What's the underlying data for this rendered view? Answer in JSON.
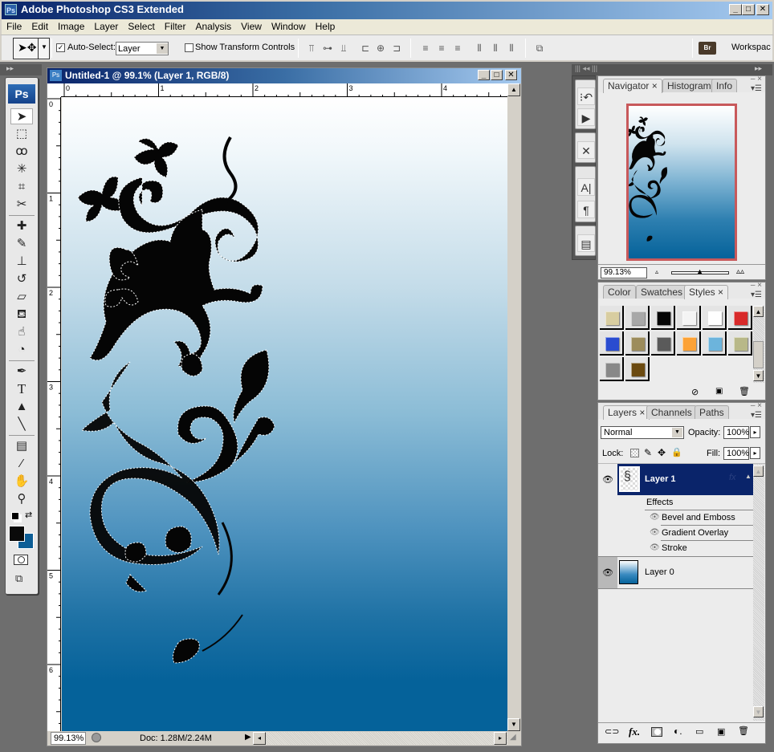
{
  "app": {
    "title": "Adobe Photoshop CS3 Extended",
    "logo": "Ps",
    "window_controls": {
      "minimize": "_",
      "maximize": "□",
      "close": "✕"
    }
  },
  "menu": [
    "File",
    "Edit",
    "Image",
    "Layer",
    "Select",
    "Filter",
    "Analysis",
    "View",
    "Window",
    "Help"
  ],
  "options_bar": {
    "tool_icon": "move-tool-icon",
    "auto_select_checked": true,
    "auto_select_label": "Auto-Select:",
    "auto_select_value": "Layer",
    "show_transform_checked": false,
    "show_transform_label": "Show Transform Controls",
    "workspace_label": "Workspac",
    "bridge_label": "Br"
  },
  "toolbox": {
    "logo": "Ps",
    "tools": [
      {
        "name": "move-tool",
        "glyph": "➤"
      },
      {
        "name": "marquee-tool",
        "glyph": "⬚"
      },
      {
        "name": "lasso-tool",
        "glyph": "ꝏ"
      },
      {
        "name": "magic-wand-tool",
        "glyph": "✳"
      },
      {
        "name": "crop-tool",
        "glyph": "⌗"
      },
      {
        "name": "slice-tool",
        "glyph": "✂"
      },
      {
        "name": "healing-brush-tool",
        "glyph": "✚"
      },
      {
        "name": "brush-tool",
        "glyph": "✎"
      },
      {
        "name": "clone-stamp-tool",
        "glyph": "⊥"
      },
      {
        "name": "history-brush-tool",
        "glyph": "↺"
      },
      {
        "name": "eraser-tool",
        "glyph": "▱"
      },
      {
        "name": "paint-bucket-tool",
        "glyph": "⛾"
      },
      {
        "name": "blur-tool",
        "glyph": "☝"
      },
      {
        "name": "dodge-tool",
        "glyph": "◔"
      },
      {
        "name": "pen-tool",
        "glyph": "✒"
      },
      {
        "name": "type-tool",
        "glyph": "T"
      },
      {
        "name": "path-selection-tool",
        "glyph": "▲"
      },
      {
        "name": "line-tool",
        "glyph": "╲"
      },
      {
        "name": "notes-tool",
        "glyph": "▤"
      },
      {
        "name": "eyedropper-tool",
        "glyph": "⁄"
      },
      {
        "name": "hand-tool",
        "glyph": "✋"
      },
      {
        "name": "zoom-tool",
        "glyph": "⚲"
      }
    ],
    "foreground_color": "#0a0a0a",
    "background_color": "#0d5e96"
  },
  "document": {
    "title": "Untitled-1 @ 99.1% (Layer 1, RGB/8)",
    "icon_label": "Ps",
    "h_ruler_labels": [
      "0",
      "1",
      "2",
      "3",
      "4"
    ],
    "v_ruler_labels": [
      "0",
      "1",
      "2",
      "3",
      "4",
      "5",
      "6"
    ],
    "zoom": "99.13%",
    "doc_info": "Doc: 1.28M/2.24M",
    "gradient_top": "#ffffff",
    "gradient_bottom": "#05629a"
  },
  "dock_icons": [
    "history-icon",
    "actions-icon",
    "tool-presets-icon",
    "character-icon",
    "paragraph-icon",
    "layer-comps-icon"
  ],
  "navigator_panel": {
    "tabs": [
      {
        "label": "Navigator",
        "active": true,
        "closable": true
      },
      {
        "label": "Histogram",
        "active": false
      },
      {
        "label": "Info",
        "active": false
      }
    ],
    "zoom_value": "99.13%",
    "zoom_slider_fraction": 0.47,
    "view_box_color": "#c8595b"
  },
  "styles_panel": {
    "tabs": [
      {
        "label": "Color",
        "active": false
      },
      {
        "label": "Swatches",
        "active": false
      },
      {
        "label": "Styles",
        "active": true,
        "closable": true
      }
    ],
    "styles": [
      {
        "name": "style-parchment",
        "color": "#d8cda0"
      },
      {
        "name": "style-gray-bevel",
        "color": "#a8a8a8"
      },
      {
        "name": "style-black",
        "color": "#050505"
      },
      {
        "name": "style-chrome",
        "color": "#f4f4f4"
      },
      {
        "name": "style-white-outline",
        "color": "#ffffff"
      },
      {
        "name": "style-red",
        "color": "#d82a2a"
      },
      {
        "name": "style-blue",
        "color": "#2a4cd0"
      },
      {
        "name": "style-mesh",
        "color": "#9c8c5c"
      },
      {
        "name": "style-dark-gray",
        "color": "#5a5a5a"
      },
      {
        "name": "style-orange-gold",
        "color": "#fca236"
      },
      {
        "name": "style-sky-blue",
        "color": "#6cb4dc"
      },
      {
        "name": "style-olive",
        "color": "#b8b888"
      },
      {
        "name": "style-checker",
        "color": "#888888"
      },
      {
        "name": "style-bronze",
        "color": "#6b4a10"
      }
    ]
  },
  "layers_panel": {
    "tabs": [
      {
        "label": "Layers",
        "active": true,
        "closable": true
      },
      {
        "label": "Channels",
        "active": false
      },
      {
        "label": "Paths",
        "active": false
      }
    ],
    "blend_mode": "Normal",
    "opacity_label": "Opacity:",
    "opacity": "100%",
    "lock_label": "Lock:",
    "fill_label": "Fill:",
    "fill": "100%",
    "layers": [
      {
        "name": "Layer 1",
        "visible": true,
        "selected": true,
        "has_fx": true,
        "effects_label": "Effects",
        "effects": [
          "Bevel and Emboss",
          "Gradient Overlay",
          "Stroke"
        ]
      },
      {
        "name": "Layer 0",
        "visible": true,
        "selected": false
      }
    ],
    "footer_icons": [
      "link-layers-icon",
      "fx-icon",
      "layer-mask-icon",
      "adjustment-layer-icon",
      "new-group-icon",
      "new-layer-icon",
      "delete-layer-icon"
    ]
  }
}
